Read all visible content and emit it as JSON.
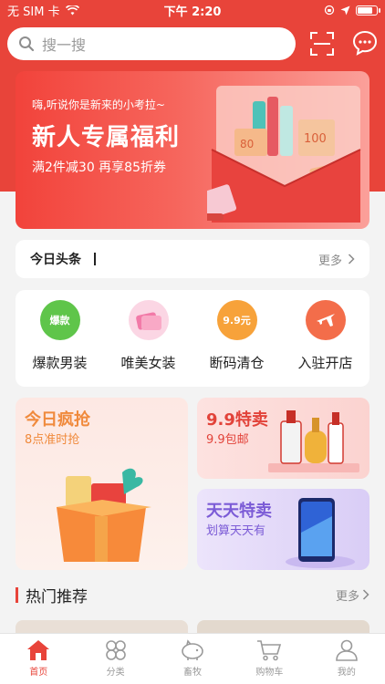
{
  "status_bar": {
    "carrier": "无 SIM 卡",
    "time": "下午 2:20",
    "battery_level": 0.85
  },
  "search": {
    "placeholder": "搜一搜"
  },
  "banner": {
    "subtitle": "嗨,听说你是新来的小考拉~",
    "title": "新人专属福利",
    "promo": "满2件减30 再享85折券",
    "coupon_values": [
      "80",
      "100",
      "100"
    ]
  },
  "headline": {
    "title": "今日头条",
    "more": "更多"
  },
  "categories": [
    {
      "label": "爆款男装",
      "badge": "爆款",
      "color": "#5fc54a"
    },
    {
      "label": "唯美女装",
      "badge": "",
      "color": "#f27aa8"
    },
    {
      "label": "断码清仓",
      "badge": "9.9元",
      "color": "#f7a23a"
    },
    {
      "label": "入驻开店",
      "badge": "",
      "color": "#f36d4a"
    }
  ],
  "tiles": {
    "flash": {
      "title": "今日疯抢",
      "subtitle": "8点准时抢"
    },
    "nine": {
      "title": "9.9特卖",
      "subtitle": "9.9包邮"
    },
    "daily": {
      "title": "天天特卖",
      "subtitle": "划算天天有"
    }
  },
  "hot": {
    "title": "热门推荐",
    "more": "更多"
  },
  "tabbar": [
    {
      "label": "首页",
      "icon": "home-icon",
      "active": true
    },
    {
      "label": "分类",
      "icon": "category-icon",
      "active": false
    },
    {
      "label": "畜牧",
      "icon": "pig-icon",
      "active": false
    },
    {
      "label": "购物车",
      "icon": "cart-icon",
      "active": false
    },
    {
      "label": "我的",
      "icon": "user-icon",
      "active": false
    }
  ],
  "colors": {
    "brand": "#e8443a",
    "background": "#f3f3f3"
  }
}
